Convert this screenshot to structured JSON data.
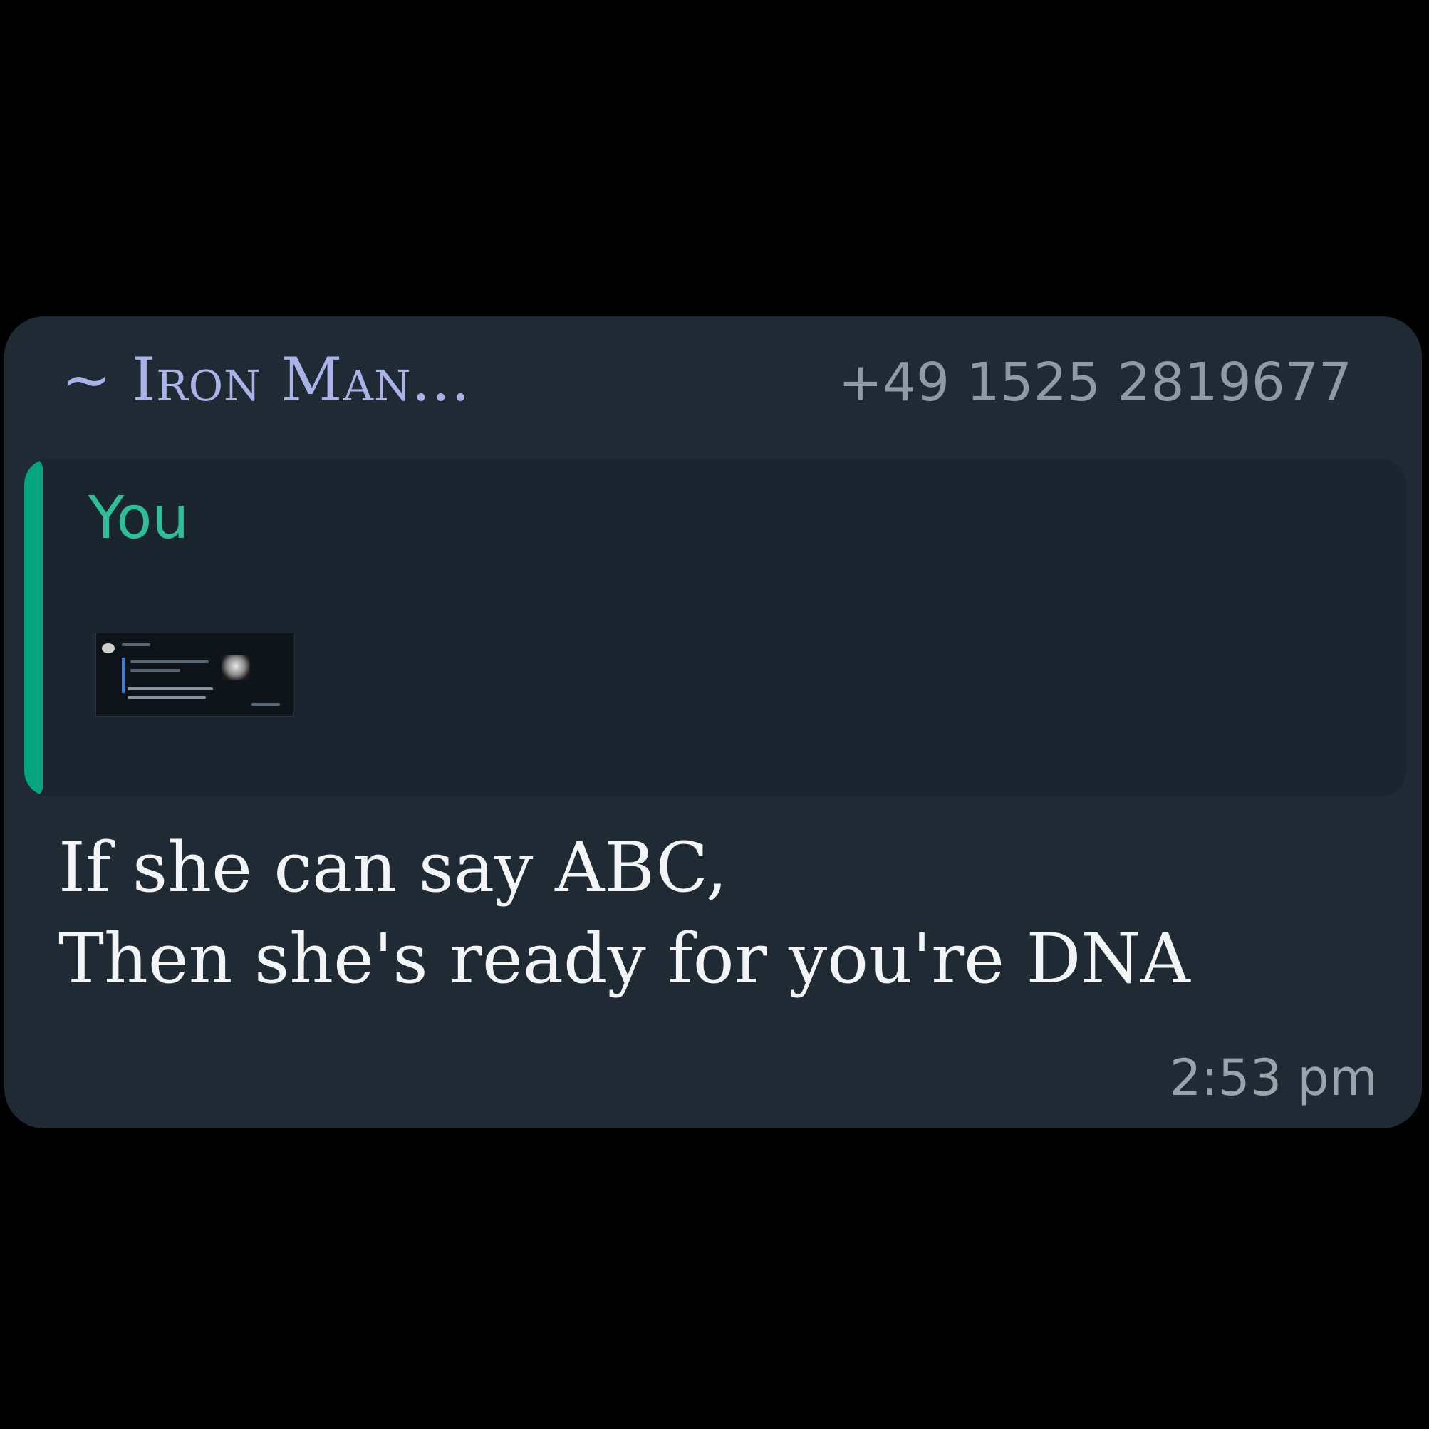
{
  "message": {
    "sender_name": "~ Iron Man...",
    "sender_phone": "+49 1525 2819677",
    "quoted": {
      "author": "You",
      "attachment_icon": "image-thumbnail-icon"
    },
    "text": "If she can say ABC,\nThen she's ready for you're DNA",
    "time": "2:53 pm"
  },
  "colors": {
    "background": "#000000",
    "bubble": "#1f2a35",
    "quote_background": "#1b2530",
    "quote_accent": "#06a57d",
    "sender_name": "#aab3e8",
    "phone": "#8f9aa6",
    "quote_author": "#2fbf98",
    "message_text": "#f3f4f6",
    "timestamp": "#9aa3ad"
  }
}
